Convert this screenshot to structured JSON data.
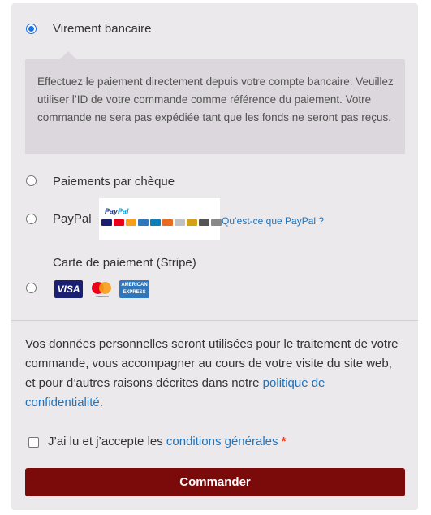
{
  "payment_methods": [
    {
      "label": "Virement bancaire",
      "selected": true
    },
    {
      "label": "Paiements par chèque",
      "selected": false
    },
    {
      "label": "PayPal",
      "selected": false
    },
    {
      "label": "Carte de paiement (Stripe)",
      "selected": false
    }
  ],
  "bank_description": "Effectuez le paiement directement depuis votre compte bancaire. Veuillez utiliser l’ID de votre commande comme référence du paiement. Votre commande ne sera pas expédiée tant que les fonds ne seront pas reçus.",
  "paypal": {
    "logo_text_pay": "Pay",
    "logo_text_pal": "Pal",
    "link_text": "Qu’est-ce que PayPal ?"
  },
  "card_icons": [
    "visa-icon",
    "mastercard-icon",
    "amex-icon"
  ],
  "card_labels": {
    "visa": "VISA",
    "mastercard": "mastercard",
    "amex_line1": "AMERICAN",
    "amex_line2": "EXPRESS"
  },
  "privacy": {
    "text_before": "Vos données personnelles seront utilisées pour le traitement de votre commande, vous accompagner au cours de votre visite du site web, et pour d’autres raisons décrites dans notre ",
    "link_text": "politique de confidentialité",
    "text_after": "."
  },
  "terms": {
    "text_before": "J’ai lu et j’accepte les ",
    "link_text": "conditions générales",
    "required_mark": "*"
  },
  "order_button_label": "Commander",
  "colors": {
    "panel_bg": "#ebe9eb",
    "description_bg": "#dcd7dc",
    "link": "#1e73be",
    "button_bg": "#7b0a0a"
  }
}
